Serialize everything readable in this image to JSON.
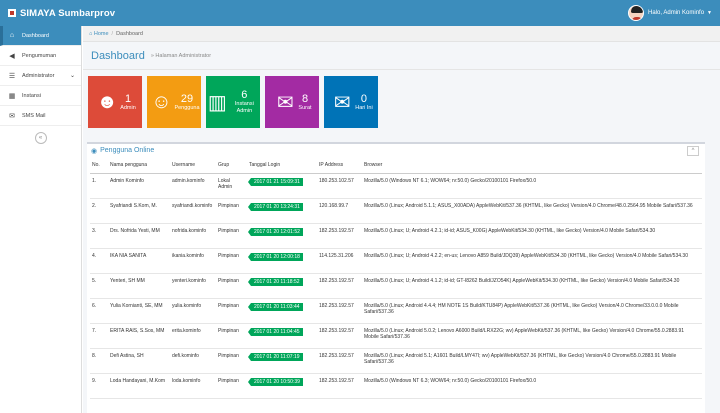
{
  "app": {
    "title": "SIMAYA Sumbarprov"
  },
  "user": {
    "name": "Halo, Admin Kominfo"
  },
  "sidebar": {
    "items": [
      {
        "label": "Dashboard",
        "icon": "home-icon"
      },
      {
        "label": "Pengumuman",
        "icon": "megaphone-icon"
      },
      {
        "label": "Administrator",
        "icon": "list-icon"
      },
      {
        "label": "Instansi",
        "icon": "building-icon"
      },
      {
        "label": "SMS Mail",
        "icon": "mail-icon"
      }
    ]
  },
  "breadcrumb": {
    "home": "Home",
    "current": "Dashboard"
  },
  "page": {
    "title": "Dashboard",
    "subtitle": "Halaman Administrator"
  },
  "tiles": [
    {
      "count": "1",
      "label": "Admin",
      "color": "#dd4b39",
      "icon": "spy-icon"
    },
    {
      "count": "29",
      "label": "Pengguna",
      "color": "#f39c12",
      "icon": "users-icon"
    },
    {
      "count": "6",
      "label": "Instansi Admin",
      "color": "#00a65a",
      "icon": "building-icon"
    },
    {
      "count": "8",
      "label": "Surat",
      "color": "#a32ba3",
      "icon": "envelope-icon"
    },
    {
      "count": "0",
      "label": "Hari Ini",
      "color": "#0073b7",
      "icon": "envelope-open-icon"
    }
  ],
  "panel": {
    "title": "Pengguna Online"
  },
  "table": {
    "headers": [
      "No.",
      "Nama pengguna",
      "Username",
      "Grup",
      "Tanggal Login",
      "IP Address",
      "Browser"
    ],
    "rows": [
      {
        "no": "1.",
        "nama": "Admin Kominfo",
        "username": "admin.kominfo",
        "grup": "Lokal Admin",
        "tanggal": "2017 01 21 15:09:31",
        "ip": "180.253.102.57",
        "browser": "Mozilla/5.0 (Windows NT 6.1; WOW64; rv:50.0) Gecko/20100101 Firefox/50.0"
      },
      {
        "no": "2.",
        "nama": "Syafriandi S.Kom, M.",
        "username": "syafriandi.kominfo",
        "grup": "Pimpinan",
        "tanggal": "2017 01 20 13:24:31",
        "ip": "120.168.99.7",
        "browser": "Mozilla/5.0 (Linux; Android 5.1.1; ASUS_X00ADA) AppleWebKit/537.36 (KHTML, like Gecko) Version/4.0 Chrome/48.0.2564.95 Mobile Safari/537.36"
      },
      {
        "no": "3.",
        "nama": "Drs. Nofrida Yesti, MM",
        "username": "nofrida.kominfo",
        "grup": "Pimpinan",
        "tanggal": "2017 01 20 12:01:52",
        "ip": "182.253.192.57",
        "browser": "Mozilla/5.0 (Linux; U; Android 4.2.1; id-id; ASUS_K00G) AppleWebKit/534.30 (KHTML, like Gecko) Version/4.0 Mobile Safari/534.30"
      },
      {
        "no": "4.",
        "nama": "IKA NIA SANITA",
        "username": "ikania.kominfo",
        "grup": "Pimpinan",
        "tanggal": "2017 01 20 12:00:18",
        "ip": "114.125.31.206",
        "browser": "Mozilla/5.0 (Linux; U; Android 4.2.2; en-us; Lenovo A859 Build/JDQ39) AppleWebKit/534.30 (KHTML, like Gecko) Version/4.0 Mobile Safari/534.30"
      },
      {
        "no": "5.",
        "nama": "Yenteri, SH MM",
        "username": "yenteri.kominfo",
        "grup": "Pimpinan",
        "tanggal": "2017 01 20 11:18:52",
        "ip": "182.253.192.57",
        "browser": "Mozilla/5.0 (Linux; U; Android 4.1.2; id-id; GT-I8262 Build/JZO54K) AppleWebKit/534.30 (KHTML, like Gecko) Version/4.0 Mobile Safari/534.30"
      },
      {
        "no": "6.",
        "nama": "Yulia Kornianti, SE, MM",
        "username": "yulia.kominfo",
        "grup": "Pimpinan",
        "tanggal": "2017 01 20 11:03:44",
        "ip": "182.253.192.57",
        "browser": "Mozilla/5.0 (Linux; Android 4.4.4; HM NOTE 1S Build/KTU84P) AppleWebKit/537.36 (KHTML, like Gecko) Version/4.0 Chrome/33.0.0.0 Mobile Safari/537.36"
      },
      {
        "no": "7.",
        "nama": "ERITA RAIS, S.Sos, MM",
        "username": "erita.kominfo",
        "grup": "Pimpinan",
        "tanggal": "2017 01 20 11:04:45",
        "ip": "182.253.192.57",
        "browser": "Mozilla/5.0 (Linux; Android 5.0.2; Lenovo A6000 Build/LRX22G; wv) AppleWebKit/537.36 (KHTML, like Gecko) Version/4.0 Chrome/55.0.2883.91 Mobile Safari/537.36"
      },
      {
        "no": "8.",
        "nama": "Defi Astina, SH",
        "username": "defi.kominfo",
        "grup": "Pimpinan",
        "tanggal": "2017 01 20 11:07:19",
        "ip": "182.253.192.57",
        "browser": "Mozilla/5.0 (Linux; Android 5.1; A1601 Build/LMY47I; wv) AppleWebKit/537.36 (KHTML, like Gecko) Version/4.0 Chrome/55.0.2883.91 Mobile Safari/537.36"
      },
      {
        "no": "9.",
        "nama": "Loda Handayani, M.Kom",
        "username": "loda.kominfo",
        "grup": "Pimpinan",
        "tanggal": "2017 01 20 10:50:39",
        "ip": "182.253.192.57",
        "browser": "Mozilla/5.0 (Windows NT 6.3; WOW64; rv:50.0) Gecko/20100101 Firefox/50.0"
      }
    ]
  }
}
